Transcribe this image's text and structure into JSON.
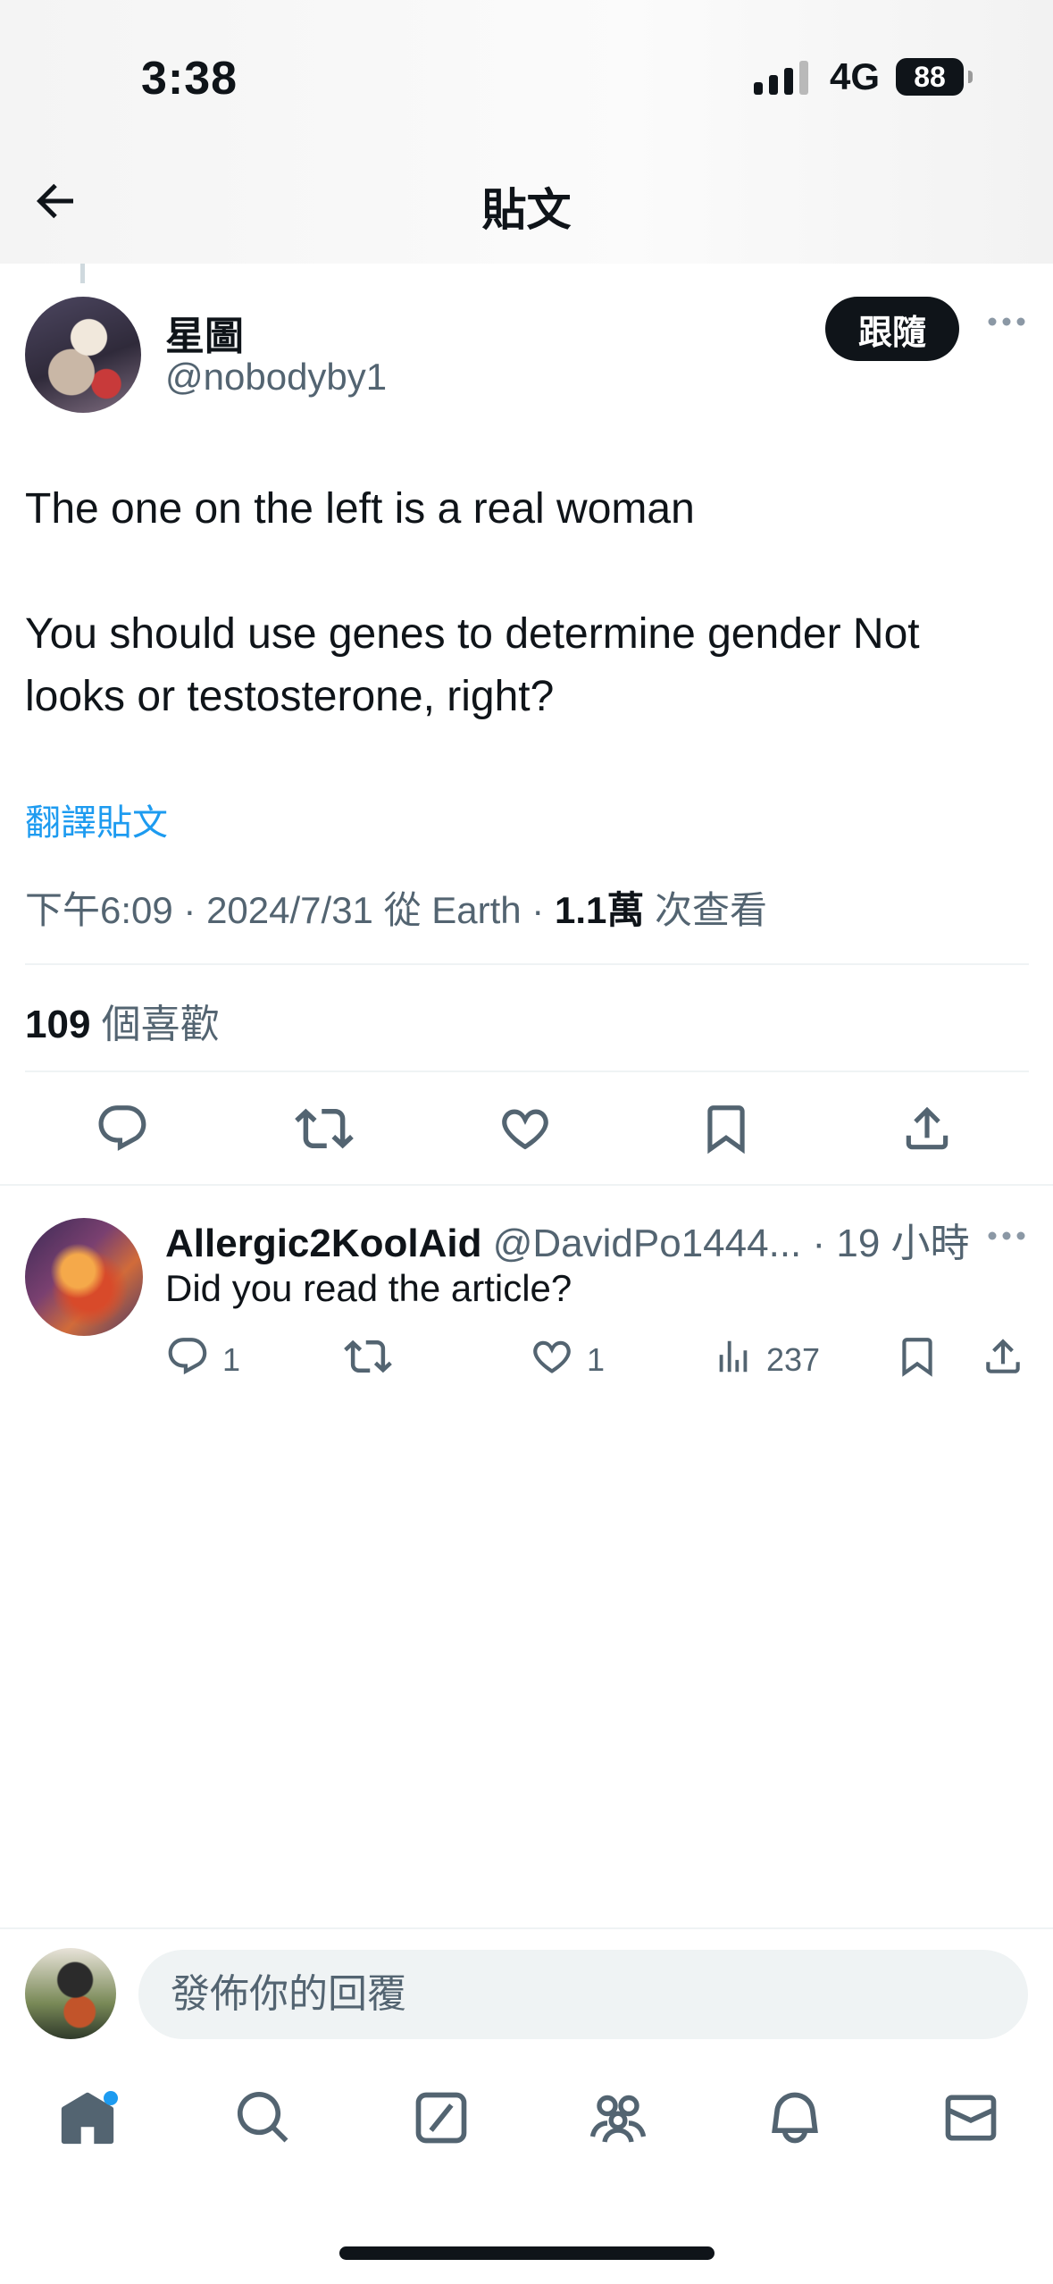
{
  "status_bar": {
    "time": "3:38",
    "network": "4G",
    "battery": "88"
  },
  "header": {
    "title": "貼文"
  },
  "post": {
    "author_name": "星圖",
    "author_handle": "@nobodyby1",
    "follow_label": "跟隨",
    "text_line1": "The one on the left is a real woman",
    "text_line2": "You should use genes to determine gender Not looks or testosterone, right?",
    "translate_label": "翻譯貼文",
    "meta_time": "下午6:09 · 2024/7/31 從 Earth · ",
    "views_count": "1.1萬",
    "views_label": " 次查看",
    "likes_count": "109",
    "likes_label": " 個喜歡"
  },
  "reply": {
    "name": "Allergic2KoolAid",
    "handle": "@DavidPo1444...",
    "time": "· 19 小時",
    "text": "Did you read the article?",
    "reply_count": "1",
    "like_count": "1",
    "views_count": "237"
  },
  "composer": {
    "placeholder": "發佈你的回覆"
  },
  "colors": {
    "accent": "#1d9bf0",
    "text": "#0f1419",
    "secondary": "#536471",
    "divider": "#eff3f4"
  },
  "icons": {
    "post_actions": [
      "reply-icon",
      "repost-icon",
      "like-icon",
      "bookmark-icon",
      "share-icon"
    ],
    "tabs": [
      "home-icon",
      "search-icon",
      "grok-icon",
      "communities-icon",
      "notifications-icon",
      "messages-icon"
    ]
  }
}
